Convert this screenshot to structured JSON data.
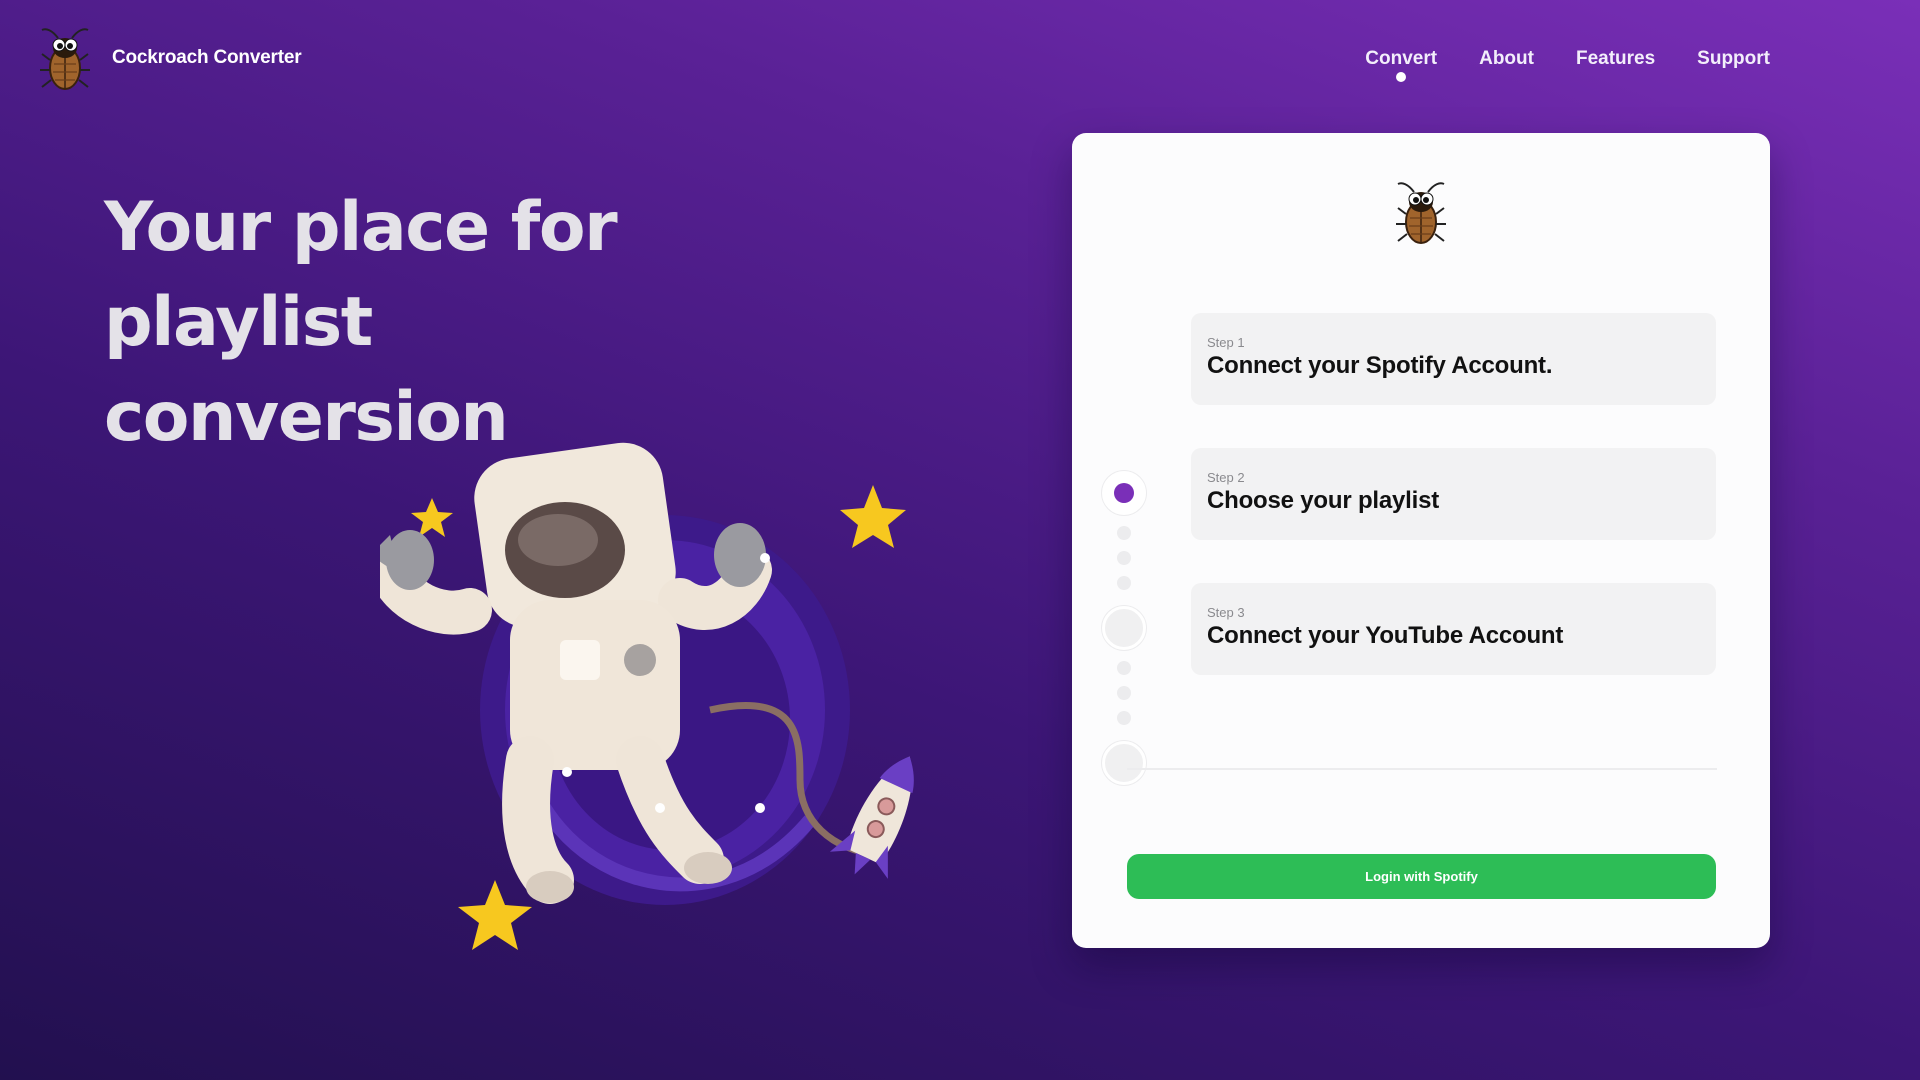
{
  "header": {
    "app_name": "Cockroach Converter",
    "logo_icon": "cockroach-icon",
    "nav": [
      {
        "label": "Convert",
        "active": true
      },
      {
        "label": "About",
        "active": false
      },
      {
        "label": "Features",
        "active": false
      },
      {
        "label": "Support",
        "active": false
      }
    ]
  },
  "hero": {
    "line1": "Your place for playlist",
    "line2": "conversion",
    "illustration": "astronaut-floating-illustration"
  },
  "card": {
    "logo_icon": "cockroach-icon",
    "steps": [
      {
        "kicker": "Step 1",
        "title": "Connect your Spotify Account.",
        "active": true
      },
      {
        "kicker": "Step 2",
        "title": "Choose your playlist",
        "active": false
      },
      {
        "kicker": "Step 3",
        "title": "Connect your YouTube Account",
        "active": false
      }
    ],
    "login_label": "Login with Spotify"
  },
  "colors": {
    "background_top": "#7a2fb8",
    "background_bottom": "#22104f",
    "accent": "#7a2fb8",
    "spotify_green": "#2dbd56"
  }
}
